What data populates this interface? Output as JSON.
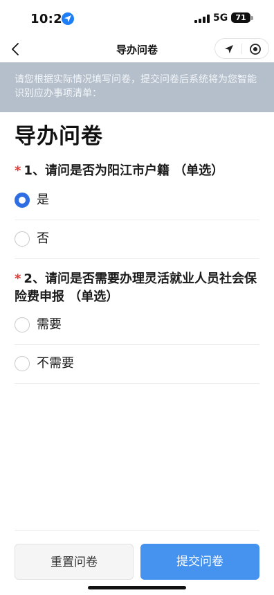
{
  "status_bar": {
    "time": "10:22",
    "network": "5G",
    "battery": "71"
  },
  "nav": {
    "title": "导办问卷"
  },
  "notice": {
    "text": "请您根据实际情况填写问卷，提交问卷后系统将为您智能识别应办事项清单："
  },
  "page": {
    "title": "导办问卷"
  },
  "questions": [
    {
      "required_mark": "*",
      "text": "1、请问是否为阳江市户籍 （单选）",
      "options": [
        {
          "label": "是",
          "selected": true
        },
        {
          "label": "否",
          "selected": false
        }
      ]
    },
    {
      "required_mark": "*",
      "text": "2、请问是否需要办理灵活就业人员社会保险费申报 （单选）",
      "options": [
        {
          "label": "需要",
          "selected": false
        },
        {
          "label": "不需要",
          "selected": false
        }
      ]
    }
  ],
  "footer": {
    "reset_label": "重置问卷",
    "submit_label": "提交问卷"
  },
  "colors": {
    "accent": "#2f6de2",
    "submit": "#4593ef",
    "notice_bg": "#b4bfcb",
    "required": "#e53935"
  }
}
